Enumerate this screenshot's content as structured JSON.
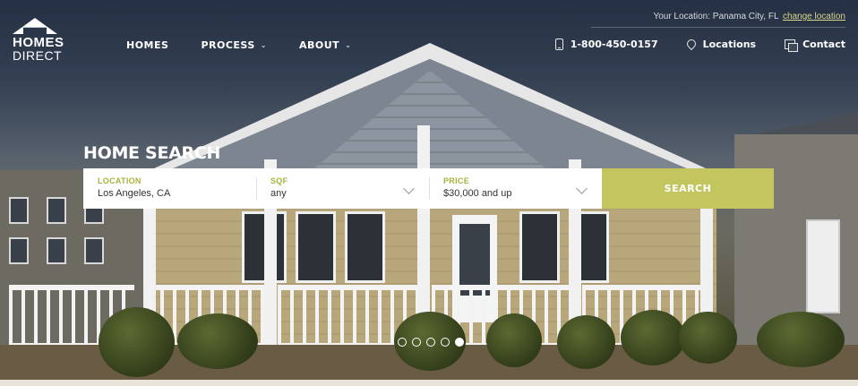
{
  "brand": {
    "line1": "HOMES",
    "line2": "DIRECT"
  },
  "nav": [
    {
      "label": "HOMES",
      "has_caret": false
    },
    {
      "label": "PROCESS",
      "has_caret": true
    },
    {
      "label": "ABOUT",
      "has_caret": true
    }
  ],
  "top_bar": {
    "location_text": "Your Location: Panama City, FL",
    "change_link": "change location"
  },
  "contact": {
    "phone": "1-800-450-0157",
    "locations": "Locations",
    "contact": "Contact"
  },
  "search": {
    "title": "HOME SEARCH",
    "location": {
      "label": "LOCATION",
      "value": "Los Angeles, CA"
    },
    "sqf": {
      "label": "SQF",
      "value": "any"
    },
    "price": {
      "label": "PRICE",
      "value": "$30,000 and up"
    },
    "button": "SEARCH"
  },
  "carousel": {
    "total": 5,
    "active_index": 4
  },
  "colors": {
    "accent": "#c3c65f",
    "label_green": "#a8b23a",
    "link": "#d6d88a"
  }
}
